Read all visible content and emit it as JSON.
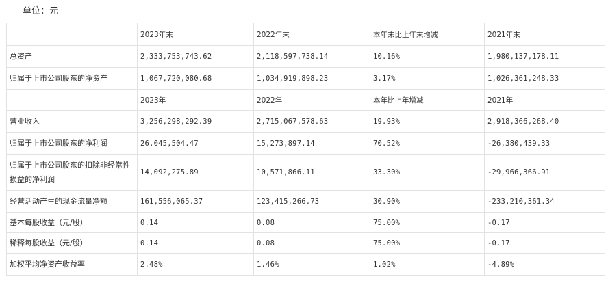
{
  "unit_label": "单位：元",
  "header1": [
    "",
    "2023年末",
    "2022年末",
    "本年末比上年末增减",
    "2021年末"
  ],
  "rows1": [
    [
      "总资产",
      "2,333,753,743.62",
      "2,118,597,738.14",
      "10.16%",
      "1,980,137,178.11"
    ],
    [
      "归属于上市公司股东的净资产",
      "1,067,720,080.68",
      "1,034,919,898.23",
      "3.17%",
      "1,026,361,248.33"
    ]
  ],
  "header2": [
    "",
    "2023年",
    "2022年",
    "本年比上年增减",
    "2021年"
  ],
  "rows2": [
    [
      "营业收入",
      "3,256,298,292.39",
      "2,715,067,578.63",
      "19.93%",
      "2,918,366,268.40"
    ],
    [
      "归属于上市公司股东的净利润",
      "26,045,504.47",
      "15,273,897.14",
      "70.52%",
      "-26,380,439.33"
    ],
    [
      "归属于上市公司股东的扣除非经常性损益的净利润",
      "14,092,275.89",
      "10,571,866.11",
      "33.30%",
      "-29,966,366.91"
    ],
    [
      "经营活动产生的现金流量净额",
      "161,556,065.37",
      "123,415,266.73",
      "30.90%",
      "-233,210,361.34"
    ],
    [
      "基本每股收益（元/股）",
      "0.14",
      "0.08",
      "75.00%",
      "-0.17"
    ],
    [
      "稀释每股收益（元/股）",
      "0.14",
      "0.08",
      "75.00%",
      "-0.17"
    ],
    [
      "加权平均净资产收益率",
      "2.48%",
      "1.46%",
      "1.02%",
      "-4.89%"
    ]
  ]
}
